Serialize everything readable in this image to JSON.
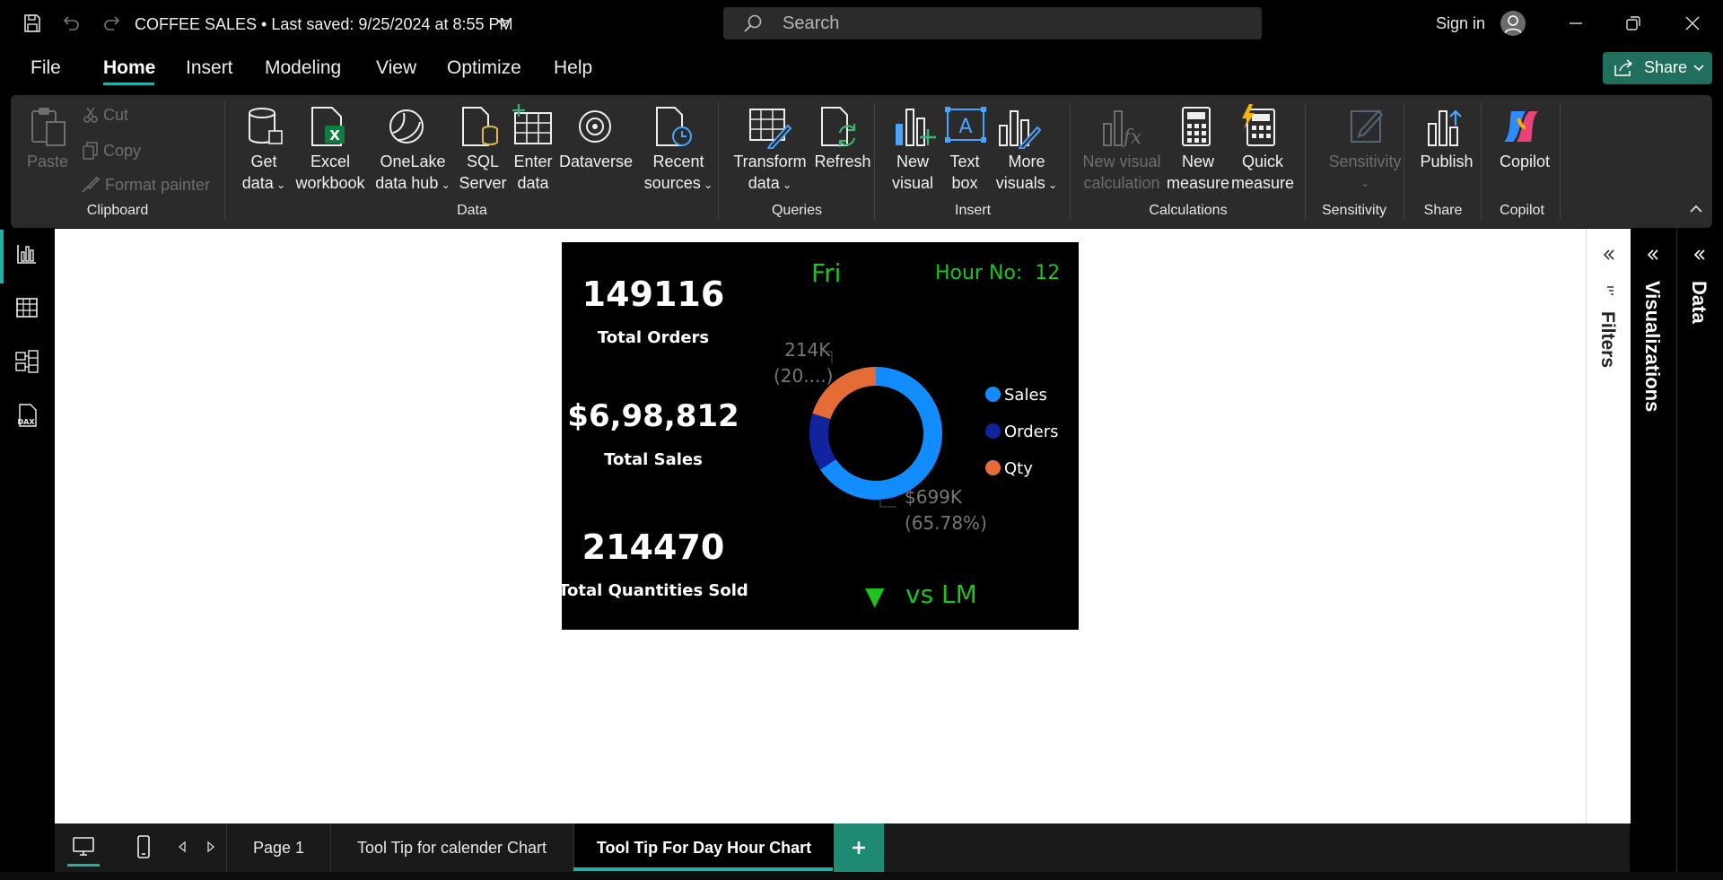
{
  "titlebar": {
    "doc_title": "COFFEE SALES • Last saved: 9/25/2024 at 8:55 PM",
    "search_placeholder": "Search",
    "sign_in": "Sign in"
  },
  "menu": {
    "tabs": [
      "File",
      "Home",
      "Insert",
      "Modeling",
      "View",
      "Optimize",
      "Help"
    ],
    "active": "Home",
    "share_label": "Share"
  },
  "ribbon": {
    "clipboard": {
      "paste": "Paste",
      "cut": "Cut",
      "copy": "Copy",
      "format_painter": "Format painter",
      "group": "Clipboard"
    },
    "data": {
      "get_data": [
        "Get",
        "data"
      ],
      "excel": [
        "Excel",
        "workbook"
      ],
      "onelake": [
        "OneLake",
        "data hub"
      ],
      "sql": [
        "SQL",
        "Server"
      ],
      "enter": [
        "Enter",
        "data"
      ],
      "dataverse": [
        "Dataverse"
      ],
      "recent": [
        "Recent",
        "sources"
      ],
      "group": "Data"
    },
    "queries": {
      "transform": [
        "Transform",
        "data"
      ],
      "refresh": [
        "Refresh"
      ],
      "group": "Queries"
    },
    "insert": {
      "new_visual": [
        "New",
        "visual"
      ],
      "text_box": [
        "Text",
        "box"
      ],
      "more_visuals": [
        "More",
        "visuals"
      ],
      "group": "Insert"
    },
    "calculations": {
      "new_visual_calc": [
        "New visual",
        "calculation"
      ],
      "new_measure": [
        "New",
        "measure"
      ],
      "quick_measure": [
        "Quick",
        "measure"
      ],
      "group": "Calculations"
    },
    "sensitivity": {
      "label": "Sensitivity",
      "group": "Sensitivity"
    },
    "share": {
      "publish": "Publish",
      "group": "Share"
    },
    "copilot": {
      "label": "Copilot",
      "group": "Copilot"
    }
  },
  "visual": {
    "day": "Fri",
    "hour_label": "Hour No:  12",
    "kpis": [
      {
        "value": "149116",
        "label": "Total Orders"
      },
      {
        "value": "$6,98,812",
        "label": "Total Sales"
      },
      {
        "value": "214470",
        "label": "Total Quantities Sold"
      }
    ],
    "vs_label": "vs LM",
    "trend_symbol": "▼",
    "data_label_top": [
      "214K",
      "(20....)"
    ],
    "data_label_bottom": [
      "$699K",
      "(65.78%)"
    ]
  },
  "chart_data": {
    "type": "pie",
    "categories": [
      "Sales",
      "Orders",
      "Qty"
    ],
    "values": [
      65.78,
      14.04,
      20.18
    ],
    "colors": [
      "#118dff",
      "#12239e",
      "#e66c37"
    ],
    "legend_position": "right",
    "donut": true
  },
  "panes": {
    "filters": "Filters",
    "visualizations": "Visualizations",
    "data": "Data"
  },
  "pages": {
    "tabs": [
      "Page 1",
      "Tool Tip for calender Chart",
      "Tool Tip For Day Hour Chart"
    ],
    "active": "Tool Tip For Day Hour Chart"
  },
  "colors": {
    "accent": "#20b2aa",
    "share_button": "#1f6f5c",
    "kpi_green": "#1ec31e"
  }
}
